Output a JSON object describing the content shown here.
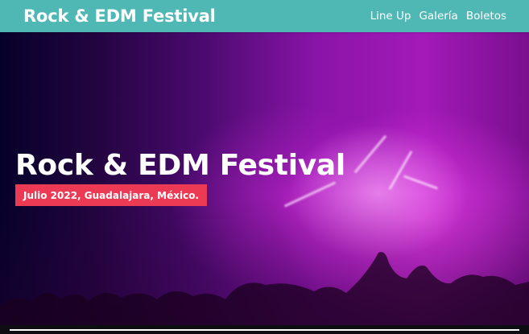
{
  "navbar": {
    "brand": "Rock & EDM Festival",
    "links": [
      {
        "label": "Line Up"
      },
      {
        "label": "Galería"
      },
      {
        "label": "Boletos"
      }
    ]
  },
  "hero": {
    "title": "Rock & EDM Festival",
    "date_badge": "Julio 2022, Guadalajara, México."
  },
  "colors": {
    "navbar_bg": "#4fb8b5",
    "badge_bg": "#ec3a55",
    "hero_dark": "#06012a",
    "hero_magenta": "#a31ab8"
  }
}
